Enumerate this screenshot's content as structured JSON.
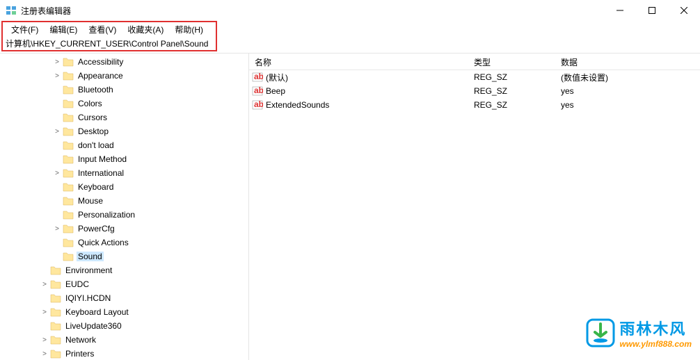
{
  "window": {
    "title": "注册表编辑器"
  },
  "menu": {
    "file": "文件(F)",
    "edit": "编辑(E)",
    "view": "查看(V)",
    "favorites": "收藏夹(A)",
    "help": "帮助(H)"
  },
  "address": {
    "path": "计算机\\HKEY_CURRENT_USER\\Control Panel\\Sound"
  },
  "tree": [
    {
      "indent": 3,
      "expand": ">",
      "label": "Accessibility"
    },
    {
      "indent": 3,
      "expand": ">",
      "label": "Appearance"
    },
    {
      "indent": 3,
      "expand": "",
      "label": "Bluetooth"
    },
    {
      "indent": 3,
      "expand": "",
      "label": "Colors"
    },
    {
      "indent": 3,
      "expand": "",
      "label": "Cursors"
    },
    {
      "indent": 3,
      "expand": ">",
      "label": "Desktop"
    },
    {
      "indent": 3,
      "expand": "",
      "label": "don't load"
    },
    {
      "indent": 3,
      "expand": "",
      "label": "Input Method"
    },
    {
      "indent": 3,
      "expand": ">",
      "label": "International"
    },
    {
      "indent": 3,
      "expand": "",
      "label": "Keyboard"
    },
    {
      "indent": 3,
      "expand": "",
      "label": "Mouse"
    },
    {
      "indent": 3,
      "expand": "",
      "label": "Personalization"
    },
    {
      "indent": 3,
      "expand": ">",
      "label": "PowerCfg"
    },
    {
      "indent": 3,
      "expand": "",
      "label": "Quick Actions"
    },
    {
      "indent": 3,
      "expand": "",
      "label": "Sound",
      "selected": true
    },
    {
      "indent": 2,
      "expand": "",
      "label": "Environment"
    },
    {
      "indent": 2,
      "expand": ">",
      "label": "EUDC"
    },
    {
      "indent": 2,
      "expand": "",
      "label": "IQIYI.HCDN"
    },
    {
      "indent": 2,
      "expand": ">",
      "label": "Keyboard Layout"
    },
    {
      "indent": 2,
      "expand": "",
      "label": "LiveUpdate360"
    },
    {
      "indent": 2,
      "expand": ">",
      "label": "Network"
    },
    {
      "indent": 2,
      "expand": ">",
      "label": "Printers"
    }
  ],
  "columns": {
    "name": "名称",
    "type": "类型",
    "data": "数据"
  },
  "values": [
    {
      "name": "(默认)",
      "type": "REG_SZ",
      "data": "(数值未设置)"
    },
    {
      "name": "Beep",
      "type": "REG_SZ",
      "data": "yes"
    },
    {
      "name": "ExtendedSounds",
      "type": "REG_SZ",
      "data": "yes"
    }
  ],
  "watermark": {
    "cn": "雨林木风",
    "url": "www.ylmf888.com"
  }
}
